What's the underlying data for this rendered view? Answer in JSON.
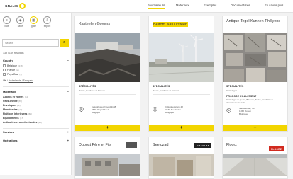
{
  "header": {
    "logo_text": "GRALIS",
    "nav": [
      {
        "label": "Fournisseurs",
        "active": true
      },
      {
        "label": "Matériaux"
      },
      {
        "label": "Exemples"
      },
      {
        "label": "Documentation"
      },
      {
        "label": "En savoir plus"
      }
    ]
  },
  "sidebar": {
    "views": [
      {
        "label": "liste",
        "icon": "list-icon"
      },
      {
        "label": "carte",
        "icon": "map-icon"
      },
      {
        "label": "grille",
        "icon": "grid-icon",
        "active": true
      },
      {
        "label": "export",
        "icon": "export-icon"
      }
    ],
    "search_placeholder": "Search",
    "results_text": "139 | 139 résultats",
    "country_label": "Country",
    "countries": [
      {
        "label": "Belgique",
        "count": "(136)"
      },
      {
        "label": "France",
        "count": "(2)"
      },
      {
        "label": "Pays-Bas",
        "count": "(1)"
      }
    ],
    "lang_prefix": "UK / ",
    "lang_link": "Nederlands / Français",
    "materials_label": "Matériaux",
    "materials_toggle": "−",
    "categories": [
      {
        "label": "Abords et voiries",
        "count": "(64)"
      },
      {
        "label": "Gros-œuvre",
        "count": "(87)"
      },
      {
        "label": "Enveloppe",
        "count": "(42)"
      },
      {
        "label": "Menuiseries",
        "count": "(19)"
      },
      {
        "label": "Finitions intérieures",
        "count": "(68)"
      },
      {
        "label": "Équipements",
        "count": "(17)"
      },
      {
        "label": "Antiquités et architecturales",
        "count": "(35)"
      }
    ],
    "services_label": "Services",
    "services_toggle": "+",
    "operations_label": "Opérations",
    "operations_toggle": "+"
  },
  "cards": [
    {
      "title": "Kasteelen Goyens",
      "highlight": false,
      "section": "SPÉCIALITÉS",
      "desc": "Pavés, bordures et briques",
      "addr1": "Industrieweg Noord 1198",
      "addr2": "3660 Opglabbeek",
      "addr3": "Belgique",
      "plus": "+"
    },
    {
      "title": "Belrom Natuursteen",
      "highlight": true,
      "section": "SPÉCIALITÉS",
      "desc": "Pavés, bordures et finitions",
      "addr1": "Industrieterrein 42",
      "addr2": "3530 Houthalen",
      "addr3": "Belgique",
      "plus": "+"
    },
    {
      "title": "Antique Tegel Kunnen-Phillyens",
      "highlight": false,
      "section": "SPÉCIALITÉS",
      "desc": "Carrelages",
      "section2": "PROPOSE ÉGALEMENT",
      "desc2": "Carrelage en pierre, Briques, Tuiles, produits en",
      "desc3": "ciment et terre cuite",
      "addr1": "Nieuwstraat, 48",
      "addr2": "1653 Rotten",
      "addr3": "Belgique",
      "plus": "+"
    },
    {
      "title": "Dubost Père et Fils",
      "highlight": false
    },
    {
      "title": "Seelozad",
      "highlight": false,
      "brand": "GRAVILAS"
    },
    {
      "title": "Floorz",
      "highlight": false,
      "brand": "FLOORZ"
    }
  ]
}
